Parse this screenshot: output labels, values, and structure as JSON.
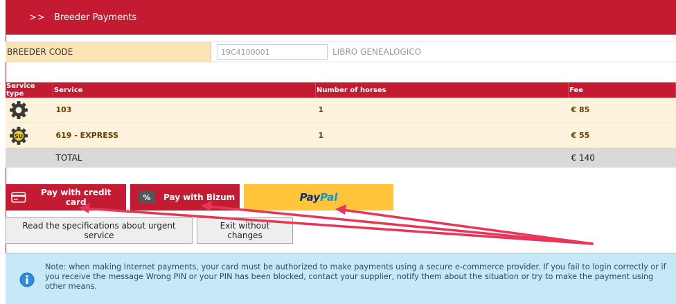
{
  "header": {
    "arrows": ">>",
    "title": "Breeder Payments"
  },
  "breeder": {
    "label": "BREEDER CODE",
    "code_value": "19C4100001",
    "book": "LIBRO GENEALOGICO"
  },
  "table": {
    "columns": [
      "Service type",
      "Service",
      "Number of horses",
      "Fee"
    ],
    "rows": [
      {
        "icon": "gear-icon",
        "service": "103",
        "horses": "1",
        "fee": "€ 85"
      },
      {
        "icon": "gear-su-icon",
        "badge": "SU",
        "service": "619 - EXPRESS",
        "horses": "1",
        "fee": "€ 55"
      }
    ],
    "total_label": "TOTAL",
    "total_value": "€ 140"
  },
  "payment": {
    "credit_label": "Pay with credit card",
    "bizum_label": "Pay with Bizum",
    "bizum_glyph": "%",
    "paypal_a": "Pay",
    "paypal_b": "Pal"
  },
  "actions": {
    "specs_label": "Read the specifications about urgent service",
    "exit_label": "Exit without changes"
  },
  "note": {
    "text": "Note: when making Internet payments, your card must be authorized to make payments using a secure e-commerce provider. If you fail to login correctly or if you receive the message Wrong PIN or your PIN has been blocked, contact your supplier, notify them about the situation or try to make the payment using other means."
  },
  "colors": {
    "brand_red": "#c41b33",
    "code_bg": "#fbe3b3",
    "row_bg": "#fdf3dc",
    "paypal_yellow": "#ffc439",
    "note_bg": "#c6e9f7"
  }
}
